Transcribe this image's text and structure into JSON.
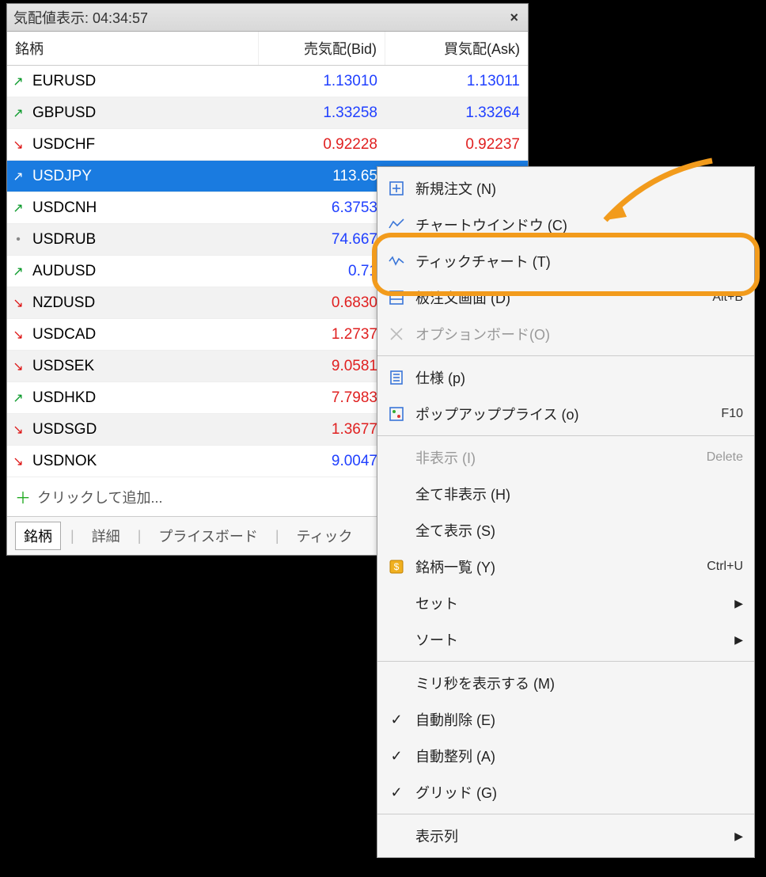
{
  "title": "気配値表示: 04:34:57",
  "headers": {
    "symbol": "銘柄",
    "bid": "売気配(Bid)",
    "ask": "買気配(Ask)"
  },
  "rows": [
    {
      "dir": "up",
      "sym": "EURUSD",
      "bid": "1.13010",
      "ask": "1.13011",
      "tone": "blue",
      "alt": false
    },
    {
      "dir": "up",
      "sym": "GBPUSD",
      "bid": "1.33258",
      "ask": "1.33264",
      "tone": "blue",
      "alt": true
    },
    {
      "dir": "down",
      "sym": "USDCHF",
      "bid": "0.92228",
      "ask": "0.92237",
      "tone": "red",
      "alt": false
    },
    {
      "dir": "up",
      "sym": "USDJPY",
      "bid": "113.65",
      "ask": "",
      "tone": "sel",
      "alt": true,
      "selected": true
    },
    {
      "dir": "up",
      "sym": "USDCNH",
      "bid": "6.3753",
      "ask": "",
      "tone": "blue",
      "alt": false
    },
    {
      "dir": "dot",
      "sym": "USDRUB",
      "bid": "74.667",
      "ask": "",
      "tone": "blue",
      "alt": true
    },
    {
      "dir": "up",
      "sym": "AUDUSD",
      "bid": "0.71",
      "ask": "",
      "tone": "blue",
      "alt": false
    },
    {
      "dir": "down",
      "sym": "NZDUSD",
      "bid": "0.6830",
      "ask": "",
      "tone": "red",
      "alt": true
    },
    {
      "dir": "down",
      "sym": "USDCAD",
      "bid": "1.2737",
      "ask": "",
      "tone": "red",
      "alt": false
    },
    {
      "dir": "down",
      "sym": "USDSEK",
      "bid": "9.0581",
      "ask": "",
      "tone": "red",
      "alt": true
    },
    {
      "dir": "up",
      "sym": "USDHKD",
      "bid": "7.7983",
      "ask": "",
      "tone": "red",
      "alt": false
    },
    {
      "dir": "down",
      "sym": "USDSGD",
      "bid": "1.3677",
      "ask": "",
      "tone": "red",
      "alt": true
    },
    {
      "dir": "down",
      "sym": "USDNOK",
      "bid": "9.0047",
      "ask": "",
      "tone": "blue",
      "alt": false
    }
  ],
  "addRow": "クリックして追加...",
  "tabs": {
    "t1": "銘柄",
    "t2": "詳細",
    "t3": "プライスボード",
    "t4": "ティック"
  },
  "menu": {
    "new_order": {
      "label": "新規注文 (N)",
      "short": ""
    },
    "chart_win": {
      "label": "チャートウインドウ (C)",
      "short": ""
    },
    "tick_chart": {
      "label": "ティックチャート (T)",
      "short": ""
    },
    "depth": {
      "label": "板注文画面 (D)",
      "short": "Alt+B"
    },
    "option": {
      "label": "オプションボード(O)",
      "short": ""
    },
    "spec": {
      "label": "仕様 (p)",
      "short": ""
    },
    "popup": {
      "label": "ポップアッププライス (o)",
      "short": "F10"
    },
    "hide": {
      "label": "非表示 (I)",
      "short": "Delete"
    },
    "hide_all": {
      "label": "全て非表示 (H)",
      "short": ""
    },
    "show_all": {
      "label": "全て表示 (S)",
      "short": ""
    },
    "sym_list": {
      "label": "銘柄一覧 (Y)",
      "short": "Ctrl+U"
    },
    "set": {
      "label": "セット",
      "short": ""
    },
    "sort": {
      "label": "ソート",
      "short": ""
    },
    "ms": {
      "label": "ミリ秒を表示する (M)",
      "short": ""
    },
    "auto_del": {
      "label": "自動削除 (E)",
      "short": ""
    },
    "auto_arr": {
      "label": "自動整列 (A)",
      "short": ""
    },
    "grid": {
      "label": "グリッド (G)",
      "short": ""
    },
    "columns": {
      "label": "表示列",
      "short": ""
    }
  }
}
